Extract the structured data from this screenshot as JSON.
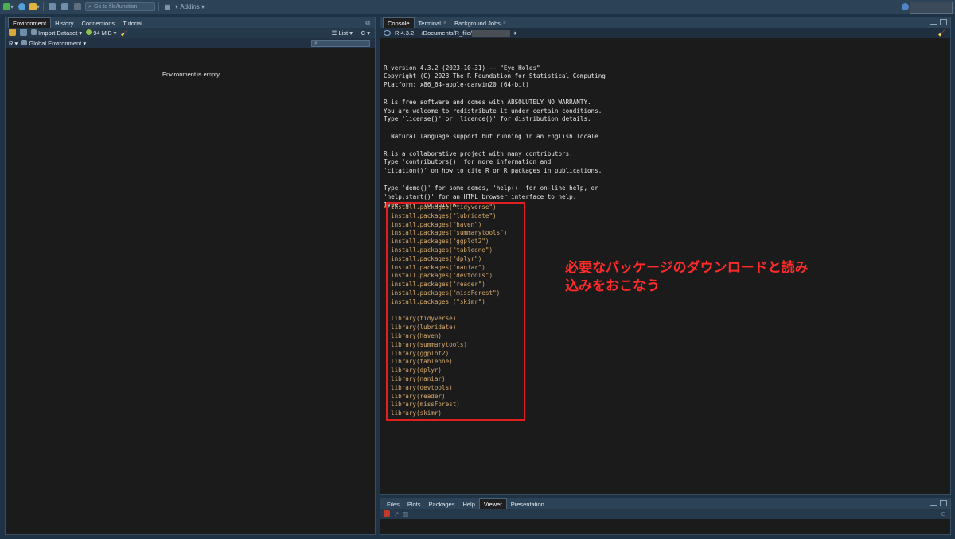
{
  "toolbar": {
    "goto_placeholder": "Go to file/function",
    "addins_label": "Addins"
  },
  "env_pane": {
    "tabs": [
      "Environment",
      "History",
      "Connections",
      "Tutorial"
    ],
    "import_label": "Import Dataset",
    "memory": "94 MiB",
    "list_label": "List",
    "lang": "R",
    "scope": "Global Environment",
    "empty_text": "Environment is empty"
  },
  "console_pane": {
    "tabs": [
      "Console",
      "Terminal",
      "Background Jobs"
    ],
    "r_version": "R 4.3.2",
    "path": "~/Documents/R_file/",
    "startup": [
      "R version 4.3.2 (2023-10-31) -- \"Eye Holes\"",
      "Copyright (C) 2023 The R Foundation for Statistical Computing",
      "Platform: x86_64-apple-darwin20 (64-bit)",
      "",
      "R is free software and comes with ABSOLUTELY NO WARRANTY.",
      "You are welcome to redistribute it under certain conditions.",
      "Type 'license()' or 'licence()' for distribution details.",
      "",
      "  Natural language support but running in an English locale",
      "",
      "R is a collaborative project with many contributors.",
      "Type 'contributors()' for more information and",
      "'citation()' on how to cite R or R packages in publications.",
      "",
      "Type 'demo()' for some demos, 'help()' for on-line help, or",
      "'help.start()' for an HTML browser interface to help.",
      "Type 'q()' to quit R."
    ],
    "prompt": ">",
    "code_lines": [
      "install.packages(\"tidyverse\")",
      "install.packages(\"lubridate\")",
      "install.packages(\"haven\")",
      "install.packages(\"summarytools\")",
      "install.packages(\"ggplot2\")",
      "install.packages(\"tableone\")",
      "install.packages(\"dplyr\")",
      "install.packages(\"naniar\")",
      "install.packages(\"devtools\")",
      "install.packages(\"reader\")",
      "install.packages(\"missForest\")",
      "install.packages (\"skimr\")",
      "",
      "library(tidyverse)",
      "library(lubridate)",
      "library(haven)",
      "library(summarytools)",
      "library(ggplot2)",
      "library(tableone)",
      "library(dplyr)",
      "library(naniar)",
      "library(devtools)",
      "library(reader)",
      "library(missForest)",
      "library(skimr)"
    ],
    "annotation_line1": "必要なパッケージのダウンロードと読み",
    "annotation_line2": "込みをおこなう"
  },
  "files_pane": {
    "tabs": [
      "Files",
      "Plots",
      "Packages",
      "Help",
      "Viewer",
      "Presentation"
    ]
  },
  "colors": {
    "annotation": "#ff2a2a",
    "code": "#d6a96a",
    "background": "#1b1b1b"
  }
}
